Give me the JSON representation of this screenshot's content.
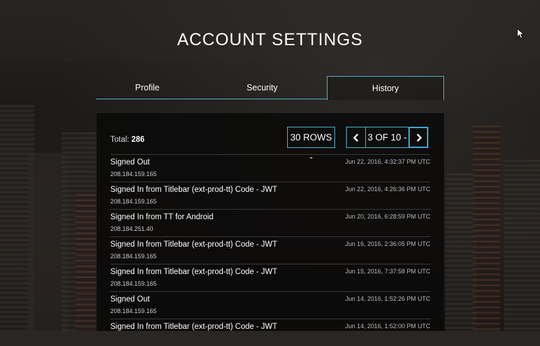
{
  "page": {
    "title": "ACCOUNT SETTINGS"
  },
  "tabs": [
    {
      "label": "Profile",
      "active": false
    },
    {
      "label": "Security",
      "active": false
    },
    {
      "label": "History",
      "active": true
    }
  ],
  "history": {
    "total_label": "Total:",
    "total_value": "286",
    "rows_selector": "30 ROWS -",
    "pagination": {
      "page_info": "3 OF 10 -",
      "prev_icon": "chevron-left-icon",
      "next_icon": "chevron-right-icon"
    },
    "entries": [
      {
        "event": "Signed Out",
        "ip": "208.184.159.165",
        "time": "Jun 22, 2016, 4:32:37 PM UTC"
      },
      {
        "event": "Signed In from Titlebar (ext-prod-tt) Code - JWT",
        "ip": "208.184.159.165",
        "time": "Jun 22, 2016, 4:26:36 PM UTC"
      },
      {
        "event": "Signed In from TT for Android",
        "ip": "208.184.251.40",
        "time": "Jun 20, 2016, 6:28:59 PM UTC"
      },
      {
        "event": "Signed In from Titlebar (ext-prod-tt) Code - JWT",
        "ip": "208.184.159.165",
        "time": "Jun 16, 2016, 2:36:05 PM UTC"
      },
      {
        "event": "Signed In from Titlebar (ext-prod-tt) Code - JWT",
        "ip": "208.184.159.165",
        "time": "Jun 15, 2016, 7:37:58 PM UTC"
      },
      {
        "event": "Signed Out",
        "ip": "208.184.159.165",
        "time": "Jun 14, 2016, 1:52:26 PM UTC"
      },
      {
        "event": "Signed In from Titlebar (ext-prod-tt) Code - JWT",
        "ip": "",
        "time": "Jun 14, 2016, 1:52:00 PM UTC"
      }
    ]
  },
  "colors": {
    "accent": "#4fb3c9",
    "active_border": "#3ea9d6",
    "panel_bg": "#080808"
  }
}
